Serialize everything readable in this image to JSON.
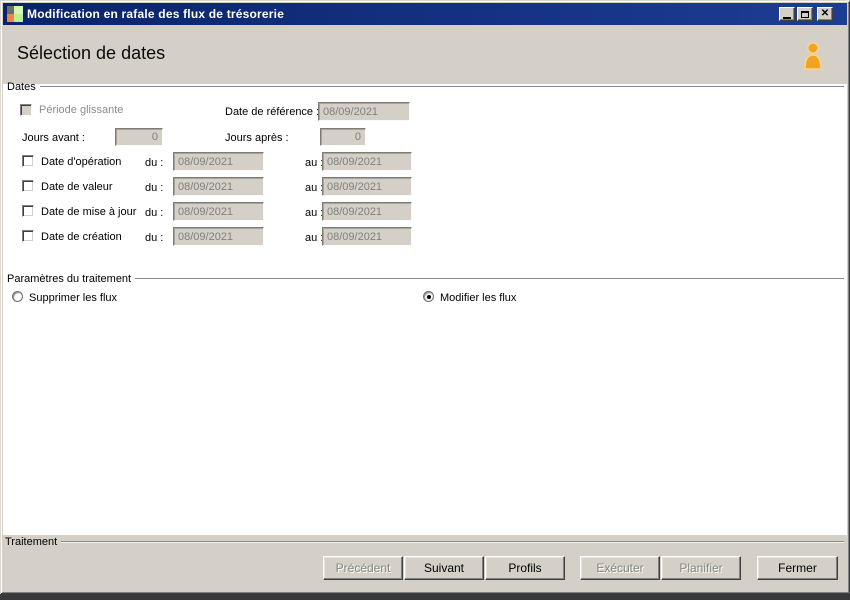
{
  "window": {
    "title": "Modification en rafale des flux de trésorerie",
    "icon": "app-grid-icon",
    "controls": [
      {
        "name": "minimize",
        "glyph": "minimize-bar"
      },
      {
        "name": "maximize",
        "glyph": "maximize-square"
      },
      {
        "name": "close",
        "glyph": "X"
      }
    ]
  },
  "header": {
    "title": "Sélection de dates",
    "icon": "user-person-icon"
  },
  "dates": {
    "legend": "Dates",
    "du_label": "du :",
    "au_label": "au :",
    "periode_glissante": {
      "label": "Période glissante",
      "checked": false,
      "enabled": false
    },
    "date_reference": {
      "label": "Date de référence :",
      "value": "08/09/2021",
      "enabled": false
    },
    "jours_avant": {
      "label": "Jours avant :",
      "value": "0",
      "enabled": false
    },
    "jours_apres": {
      "label": "Jours après :",
      "value": "0",
      "enabled": false
    },
    "rows": [
      {
        "label": "Date d'opération",
        "checked": false,
        "du": "08/09/2021",
        "au": "08/09/2021"
      },
      {
        "label": "Date de valeur",
        "checked": false,
        "du": "08/09/2021",
        "au": "08/09/2021"
      },
      {
        "label": "Date de mise à jour",
        "checked": false,
        "du": "08/09/2021",
        "au": "08/09/2021"
      },
      {
        "label": "Date de création",
        "checked": false,
        "du": "08/09/2021",
        "au": "08/09/2021"
      }
    ]
  },
  "parametres": {
    "legend": "Paramètres du traitement",
    "options": [
      {
        "label": "Supprimer les flux",
        "selected": false
      },
      {
        "label": "Modifier les flux",
        "selected": true
      }
    ]
  },
  "traitement": {
    "legend": "Traitement"
  },
  "buttons": [
    {
      "label": "Précédent",
      "enabled": false
    },
    {
      "label": "Suivant",
      "enabled": true
    },
    {
      "label": "Profils",
      "enabled": true
    },
    {
      "label": "Exécuter",
      "enabled": false
    },
    {
      "label": "Planifier",
      "enabled": false
    },
    {
      "label": "Fermer",
      "enabled": true
    }
  ],
  "colors": {
    "titlebar": "#0a246a",
    "window_face": "#d4d0c8",
    "content_bg": "#ffffff",
    "disabled_text": "#808080",
    "accent_orange": "#f0a325"
  }
}
